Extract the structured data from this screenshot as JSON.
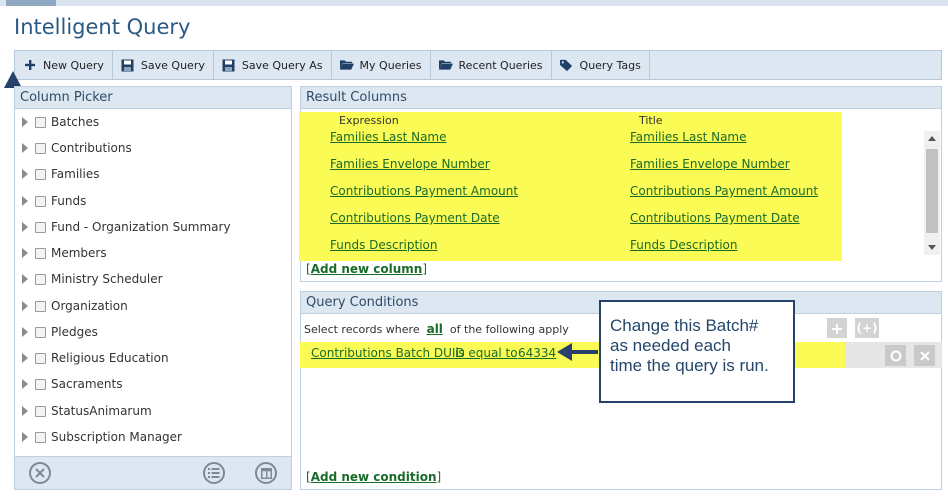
{
  "app": {
    "title": "Intelligent Query"
  },
  "toolbar": {
    "new_query": "New Query",
    "save_query": "Save Query",
    "save_query_as": "Save Query As",
    "my_queries": "My Queries",
    "recent_queries": "Recent Queries",
    "query_tags": "Query Tags",
    "icons": [
      "plus-icon",
      "floppy-disk-icon",
      "floppy-disk-icon",
      "folder-open-icon",
      "folder-open-icon",
      "tag-icon"
    ]
  },
  "column_picker": {
    "header": "Column Picker",
    "items": [
      {
        "label": "Batches"
      },
      {
        "label": "Contributions"
      },
      {
        "label": "Families"
      },
      {
        "label": "Funds"
      },
      {
        "label": "Fund - Organization Summary"
      },
      {
        "label": "Members"
      },
      {
        "label": "Ministry Scheduler"
      },
      {
        "label": "Organization"
      },
      {
        "label": "Pledges"
      },
      {
        "label": "Religious Education"
      },
      {
        "label": "Sacraments"
      },
      {
        "label": "StatusAnimarum"
      },
      {
        "label": "Subscription Manager"
      }
    ],
    "footer_icons": [
      "clear-circle-x-icon",
      "list-circle-icon",
      "layout-circle-icon"
    ]
  },
  "result_columns": {
    "header": "Result Columns",
    "col_expression": "Expression",
    "col_title": "Title",
    "rows": [
      {
        "expression": "Families Last Name",
        "title": "Families Last Name"
      },
      {
        "expression": "Families Envelope Number",
        "title": "Families Envelope Number"
      },
      {
        "expression": "Contributions Payment Amount",
        "title": "Contributions Payment Amount"
      },
      {
        "expression": "Contributions Payment Date",
        "title": "Contributions Payment Date"
      },
      {
        "expression": "Funds Description",
        "title": "Funds Description"
      }
    ],
    "add_column": "Add new column",
    "highlight_color": "#fbfb55"
  },
  "query_conditions": {
    "header": "Query Conditions",
    "select_prefix": "Select records where",
    "select_mode": "all",
    "select_suffix": "of the following apply",
    "condition": {
      "field": "Contributions Batch DUID",
      "operator": "is equal to",
      "value": "64334"
    },
    "add_condition": "Add new condition",
    "add_icon": "+",
    "group_icon": "(+)"
  },
  "callout": {
    "lines": [
      "Change this Batch#",
      "as needed each",
      "time the query is run."
    ],
    "border_color": "#27416a"
  },
  "colors": {
    "accent": "#2a5a84",
    "link": "#1a6b2a",
    "panel_header": "#dce7f2"
  }
}
